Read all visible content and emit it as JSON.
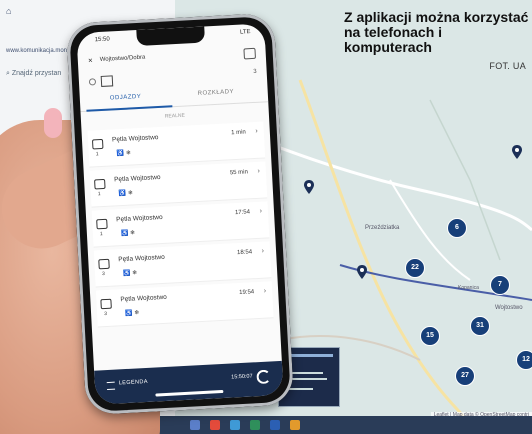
{
  "caption": {
    "headline": "Z aplikacji można korzystać na telefo­nach i komputerach",
    "credit": "FOT. UA"
  },
  "monitor": {
    "search_placeholder": "Znajdź przystan",
    "header_text": "www.komunikacja.mon",
    "map_attribution": "Leaflet | Map data © OpenStreetMap contri",
    "map_markers": [
      "6",
      "22",
      "7",
      "31",
      "15",
      "27",
      "12"
    ],
    "map_place_labels": [
      "Przeździatka",
      "Wojtostwo",
      "Kopanica"
    ]
  },
  "phone": {
    "status_time": "15:50",
    "status_signal": "LTE",
    "app_title": "Wojtostwo/Dobra",
    "row_number": "3",
    "tabs": {
      "active": "ODJAZDY",
      "inactive": "ROZKŁADY"
    },
    "section_label": "REALNE",
    "departures": [
      {
        "line": "1",
        "stop": "Pętla Wojtostwo",
        "time": "1 min"
      },
      {
        "line": "1",
        "stop": "Pętla Wojtostwo",
        "time": "55 min"
      },
      {
        "line": "1",
        "stop": "Pętla Wojtostwo",
        "time": "17:54"
      },
      {
        "line": "3",
        "stop": "Pętla Wojtostwo",
        "time": "18:54"
      },
      {
        "line": "3",
        "stop": "Pętla Wojtostwo",
        "time": "19:54"
      }
    ],
    "accessibility_glyphs": "♿ ❄",
    "footer": {
      "legend_label": "LEGENDA",
      "clock": "15:50:07"
    }
  },
  "colors": {
    "app_navy": "#1a2d4e",
    "marker_navy": "#173f79",
    "accent_blue": "#1e5aa8"
  }
}
